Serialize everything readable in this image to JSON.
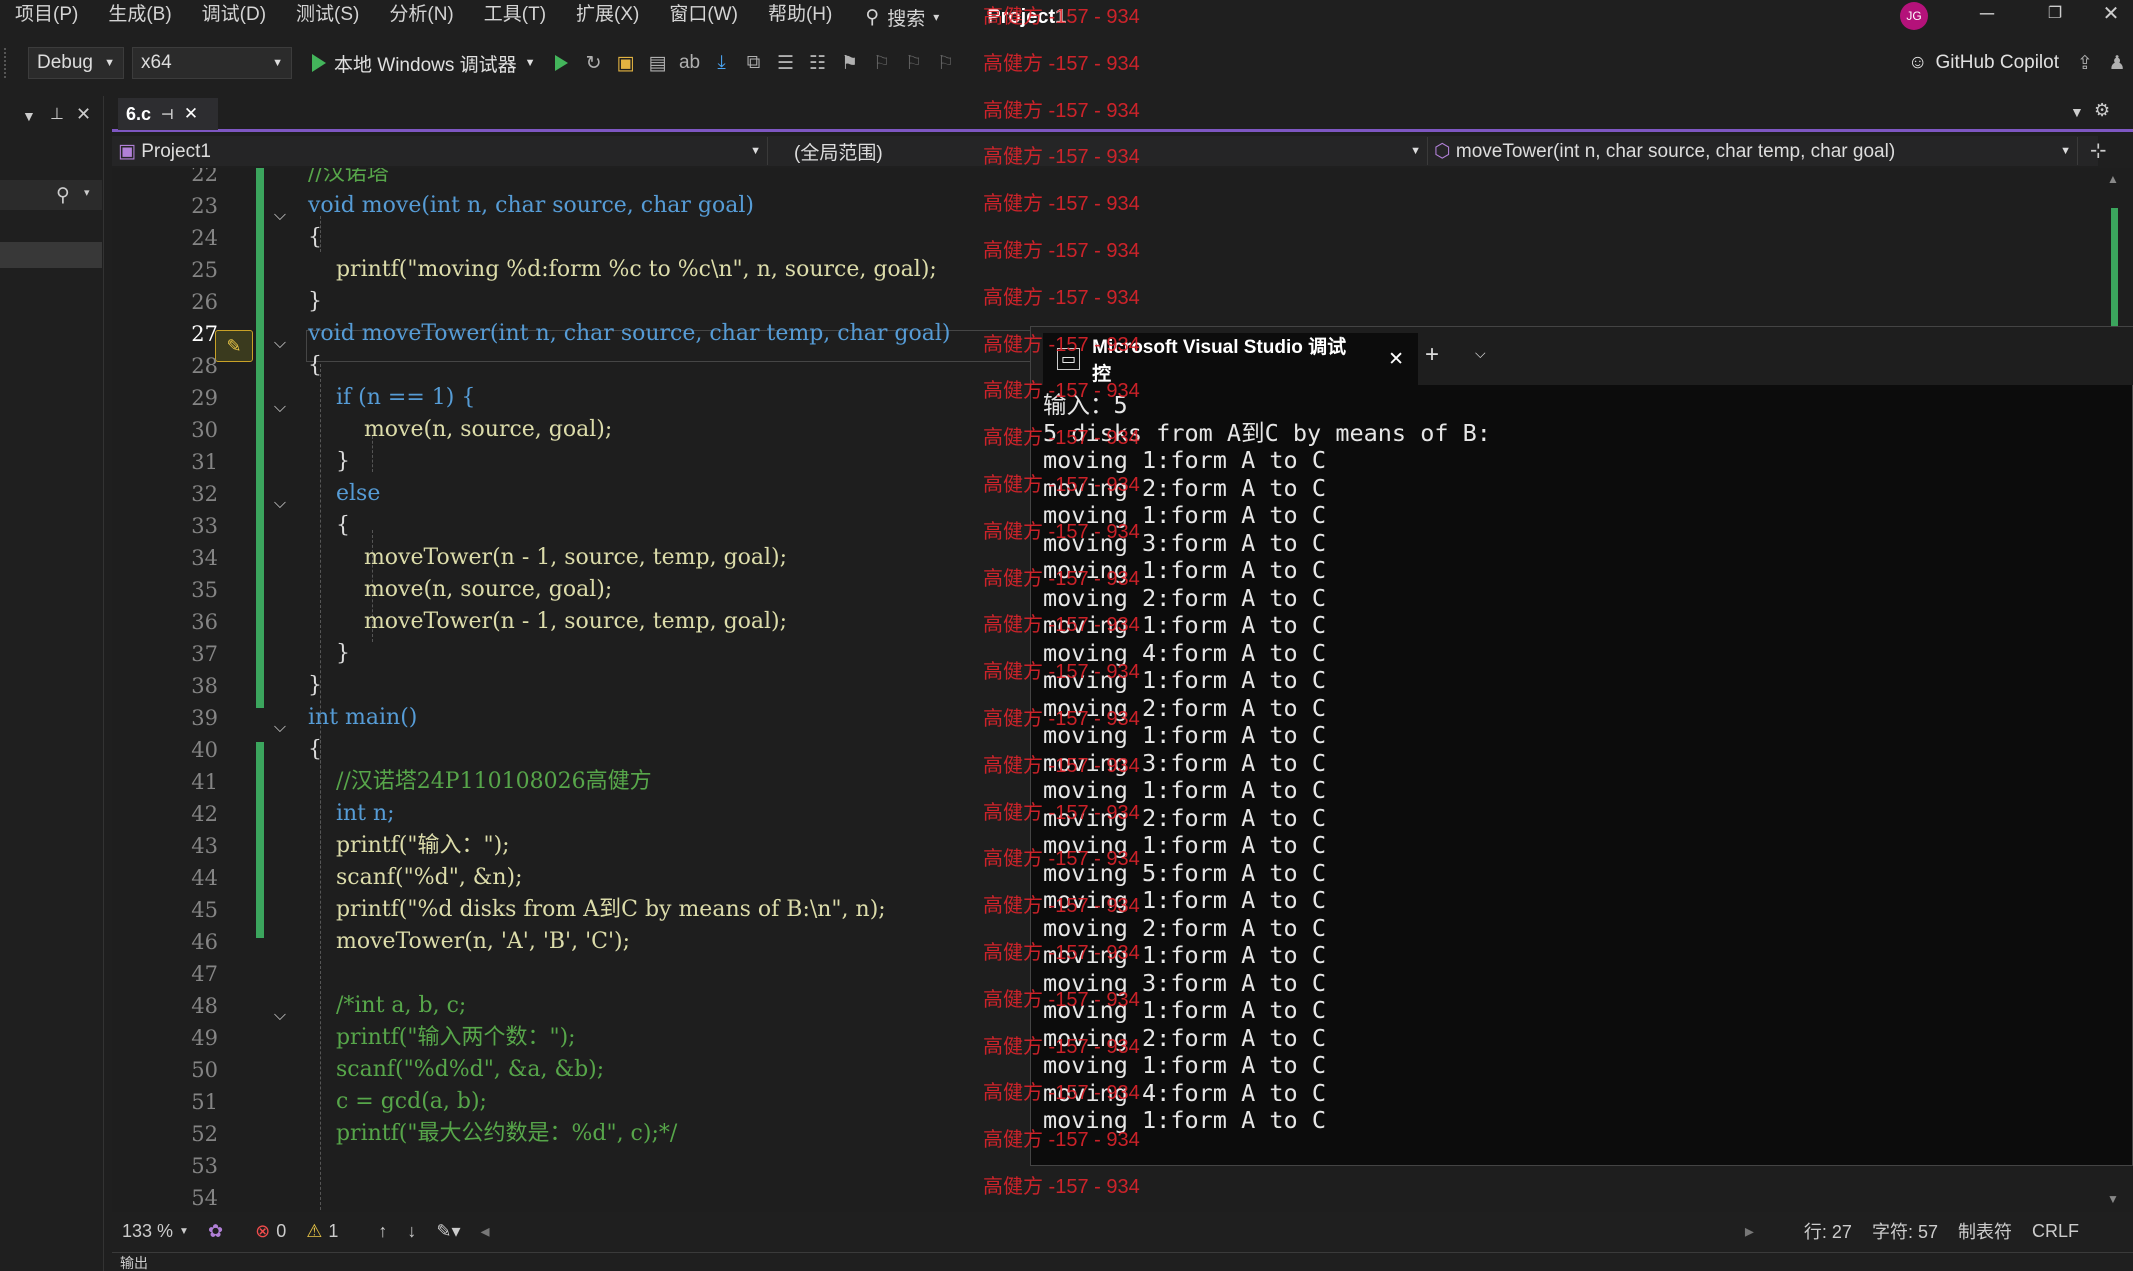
{
  "menubar": {
    "items": [
      "项目(P)",
      "生成(B)",
      "调试(D)",
      "测试(S)",
      "分析(N)",
      "工具(T)",
      "扩展(X)",
      "窗口(W)",
      "帮助(H)"
    ],
    "search": "搜索",
    "project_title": "Project1",
    "avatar": "JG"
  },
  "toolbar": {
    "config": "Debug",
    "platform": "x64",
    "run_label": "本地 Windows 调试器",
    "copilot": "GitHub Copilot"
  },
  "tab": {
    "name": "6.c"
  },
  "navbar": {
    "project": "Project1",
    "scope": "(全局范围)",
    "member": "moveTower(int n, char source, char temp, char goal)"
  },
  "editor": {
    "line_numbers": [
      "22",
      "23",
      "24",
      "25",
      "26",
      "27",
      "28",
      "29",
      "30",
      "31",
      "32",
      "33",
      "34",
      "35",
      "36",
      "37",
      "38",
      "39",
      "40",
      "41",
      "42",
      "43",
      "44",
      "45",
      "46",
      "47",
      "48",
      "49",
      "50",
      "51",
      "52",
      "53",
      "54"
    ],
    "lines": [
      "//汉诺塔",
      "void move(int n, char source, char goal)",
      "{",
      "    printf(\"moving %d:form %c to %c\\n\", n, source, goal);",
      "}",
      "void moveTower(int n, char source, char temp, char goal)",
      "{",
      "    if (n == 1) {",
      "        move(n, source, goal);",
      "    }",
      "    else",
      "    {",
      "        moveTower(n - 1, source, temp, goal);",
      "        move(n, source, goal);",
      "        moveTower(n - 1, source, temp, goal);",
      "    }",
      "}",
      "int main()",
      "{",
      "    //汉诺塔24P110108026高健方",
      "    int n;",
      "    printf(\"输入：\");",
      "    scanf(\"%d\", &n);",
      "    printf(\"%d disks from A到C by means of B:\\n\", n);",
      "    moveTower(n, 'A', 'B', 'C');",
      "",
      "    /*int a, b, c;",
      "    printf(\"输入两个数：\");",
      "    scanf(\"%d%d\", &a, &b);",
      "    c = gcd(a, b);",
      "    printf(\"最大公约数是：%d\", c);*/",
      "",
      ""
    ]
  },
  "console": {
    "tab_title": "Microsoft Visual Studio 调试控",
    "lines": [
      "输入：5",
      "5 disks from A到C by means of B:",
      "moving 1:form A to C",
      "moving 2:form A to C",
      "moving 1:form A to C",
      "moving 3:form A to C",
      "moving 1:form A to C",
      "moving 2:form A to C",
      "moving 1:form A to C",
      "moving 4:form A to C",
      "moving 1:form A to C",
      "moving 2:form A to C",
      "moving 1:form A to C",
      "moving 3:form A to C",
      "moving 1:form A to C",
      "moving 2:form A to C",
      "moving 1:form A to C",
      "moving 5:form A to C",
      "moving 1:form A to C",
      "moving 2:form A to C",
      "moving 1:form A to C",
      "moving 3:form A to C",
      "moving 1:form A to C",
      "moving 2:form A to C",
      "moving 1:form A to C",
      "moving 4:form A to C",
      "moving 1:form A to C"
    ]
  },
  "watermark": "高健方 -157 - 934",
  "statusbar": {
    "zoom": "133 %",
    "errors": "0",
    "warnings": "1",
    "line": "行: 27",
    "char": "字符: 57",
    "tabs": "制表符",
    "eol": "CRLF"
  },
  "bottompanel": {
    "title": "输出"
  },
  "colors": {
    "accent": "#7e57c2",
    "change_bar": "#3ba55d",
    "watermark": "#e0242c",
    "run": "#43b55b"
  }
}
